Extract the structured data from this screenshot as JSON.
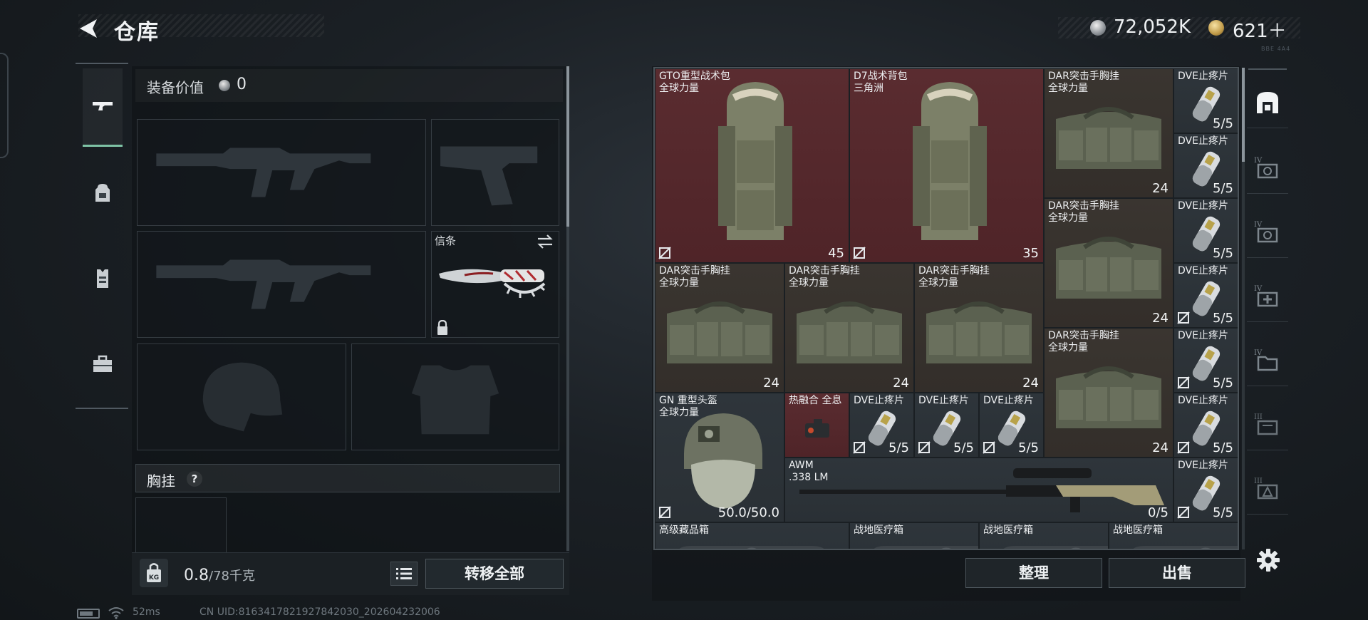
{
  "header": {
    "title": "仓库",
    "currency_main": "72,052K",
    "currency_premium": "621＋",
    "tiny_note": "BBE 4A4"
  },
  "left_tabs": [
    "pistol-icon",
    "backpack-icon",
    "vest-icon",
    "toolbox-icon"
  ],
  "equipment": {
    "value_label": "装备价值",
    "value": "0",
    "melee_label": "信条",
    "rig_section": "胸挂",
    "rig_help": "?",
    "weight_current": "0.8",
    "weight_max": "/78千克",
    "weight_badge": "KG",
    "transfer_all": "转移全部"
  },
  "storage": {
    "items": [
      {
        "name": "GTO重型战术包",
        "sub": "全球力量",
        "count": "45",
        "bg": "red"
      },
      {
        "name": "D7战术背包",
        "sub": "三角洲",
        "count": "35",
        "bg": "red"
      },
      {
        "name": "DAR突击手胸挂",
        "sub": "全球力量",
        "count": "24",
        "bg": "brown"
      },
      {
        "name": "DVE止疼片",
        "sub": "",
        "count": "5/5",
        "bg": "dark"
      },
      {
        "name": "DVE止疼片",
        "sub": "",
        "count": "5/5",
        "bg": "dark"
      },
      {
        "name": "DAR突击手胸挂",
        "sub": "全球力量",
        "count": "24",
        "bg": "brown"
      },
      {
        "name": "DVE止疼片",
        "sub": "",
        "count": "5/5",
        "bg": "dark"
      },
      {
        "name": "DAR突击手胸挂",
        "sub": "全球力量",
        "count": "24",
        "bg": "brown"
      },
      {
        "name": "DAR突击手胸挂",
        "sub": "全球力量",
        "count": "24",
        "bg": "brown"
      },
      {
        "name": "DAR突击手胸挂",
        "sub": "全球力量",
        "count": "24",
        "bg": "brown"
      },
      {
        "name": "DVE止疼片",
        "sub": "",
        "count": "5/5",
        "bg": "dark"
      },
      {
        "name": "DAR突击手胸挂",
        "sub": "全球力量",
        "count": "24",
        "bg": "brown"
      },
      {
        "name": "DVE止疼片",
        "sub": "",
        "count": "5/5",
        "bg": "dark"
      },
      {
        "name": "GN 重型头盔",
        "sub": "全球力量",
        "count": "50.0/50.0",
        "bg": "dark"
      },
      {
        "name": "热融合 全息",
        "sub": "",
        "count": "",
        "bg": "red"
      },
      {
        "name": "DVE止疼片",
        "sub": "",
        "count": "5/5",
        "bg": "dark"
      },
      {
        "name": "DVE止疼片",
        "sub": "",
        "count": "5/5",
        "bg": "dark"
      },
      {
        "name": "DVE止疼片",
        "sub": "",
        "count": "5/5",
        "bg": "dark"
      },
      {
        "name": "DVE止疼片",
        "sub": "",
        "count": "5/5",
        "bg": "dark"
      },
      {
        "name": "AWM",
        "sub": ".338 LM",
        "count": "0/5",
        "bg": "dark"
      },
      {
        "name": "DVE止疼片",
        "sub": "",
        "count": "5/5",
        "bg": "dark"
      },
      {
        "name": "高级藏品箱",
        "sub": "",
        "count": "",
        "bg": "dark"
      },
      {
        "name": "战地医疗箱",
        "sub": "",
        "count": "",
        "bg": "dark"
      },
      {
        "name": "战地医疗箱",
        "sub": "",
        "count": "",
        "bg": "dark"
      },
      {
        "name": "战地医疗箱",
        "sub": "",
        "count": "",
        "bg": "dark"
      }
    ],
    "sort_label": "整理",
    "sell_label": "出售"
  },
  "right_tabs": [
    "storage-home-icon",
    "case-iv-icon",
    "case-iv-2-icon",
    "medkit-iv-icon",
    "folder-iv-icon",
    "case-iii-icon",
    "warning-iii-icon"
  ],
  "status": {
    "ping": "52ms",
    "uid": "CN UID:8163417821927842030_202604232006"
  },
  "colors": {
    "accent_green": "#7ec2a5",
    "rarity_red": "#5a2c30",
    "rarity_brown": "#3a3530"
  }
}
